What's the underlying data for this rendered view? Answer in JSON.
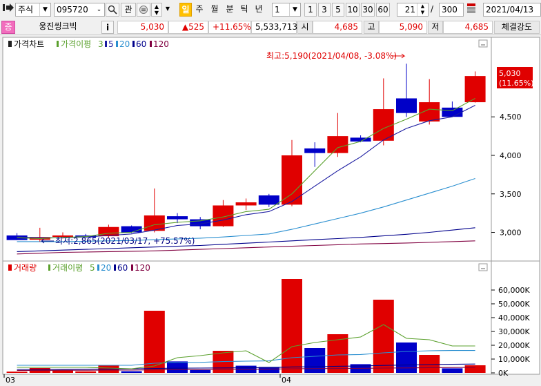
{
  "toolbar": {
    "market": "주식",
    "code": "095720",
    "interest_label": "관",
    "period_tabs": [
      "일",
      "주",
      "월",
      "분",
      "틱",
      "년"
    ],
    "active_period": "일",
    "interval_value": "1",
    "interval_buttons": [
      "1",
      "3",
      "5",
      "10",
      "30",
      "60"
    ],
    "visible_count": "21",
    "total_separator": "/",
    "total_count": "300",
    "date": "2021/04/13"
  },
  "quote": {
    "badge": "증",
    "name": "웅진씽크빅",
    "info_label": "i",
    "price": "5,030",
    "change": "▲525",
    "change_pct": "+11.65%",
    "volume": "5,533,713",
    "open_label": "시",
    "open": "4,685",
    "high_label": "고",
    "high": "5,090",
    "low_label": "저",
    "low": "4,685",
    "strength_label": "체결강도"
  },
  "price_panel": {
    "legend": {
      "title": "가격차트",
      "ma_label": "가격이평",
      "periods": [
        "3",
        "5",
        "20",
        "60",
        "120"
      ]
    },
    "current_price": "5,030",
    "current_pct": "(11.65%)",
    "max_annotation": "최고:5,190(2021/04/08, -3.08%)",
    "min_annotation": "최저:2,865(2021/03/17, +75.57%)",
    "y_ticks": [
      "4,500",
      "4,000",
      "3,500",
      "3,000"
    ]
  },
  "volume_panel": {
    "legend": {
      "title": "거래량",
      "ma_label": "거래이평",
      "periods": [
        "5",
        "20",
        "60",
        "120"
      ]
    },
    "y_ticks": [
      "60,000K",
      "50,000K",
      "40,000K",
      "30,000K",
      "20,000K",
      "10,000K",
      "0K"
    ]
  },
  "x_labels": [
    "03",
    "04"
  ],
  "colors": {
    "up": "#e00000",
    "down": "#0000c8",
    "ma3": "#5aa02c",
    "ma5": "#1a1aa0",
    "ma20": "#2a8fd0",
    "ma60": "#00008b",
    "ma120": "#800040"
  },
  "chart_data": [
    {
      "type": "candlestick",
      "title": "가격차트",
      "x_ticks": [
        "03",
        "04"
      ],
      "candles": [
        {
          "open": 2960,
          "high": 2990,
          "low": 2900,
          "close": 2900
        },
        {
          "open": 2905,
          "high": 3060,
          "low": 2880,
          "close": 2940
        },
        {
          "open": 2945,
          "high": 3000,
          "low": 2920,
          "close": 2960
        },
        {
          "open": 2960,
          "high": 2980,
          "low": 2930,
          "close": 2935
        },
        {
          "open": 2950,
          "high": 3100,
          "low": 2930,
          "close": 3070
        },
        {
          "open": 3080,
          "high": 3090,
          "low": 2990,
          "close": 3000
        },
        {
          "open": 3020,
          "high": 3570,
          "low": 3000,
          "close": 3220
        },
        {
          "open": 3210,
          "high": 3250,
          "low": 3120,
          "close": 3170
        },
        {
          "open": 3170,
          "high": 3200,
          "low": 3040,
          "close": 3080
        },
        {
          "open": 3080,
          "high": 3420,
          "low": 3070,
          "close": 3350
        },
        {
          "open": 3350,
          "high": 3440,
          "low": 3290,
          "close": 3390
        },
        {
          "open": 3480,
          "high": 3500,
          "low": 3330,
          "close": 3360
        },
        {
          "open": 3360,
          "high": 4200,
          "low": 3340,
          "close": 4000
        },
        {
          "open": 4090,
          "high": 4170,
          "low": 3850,
          "close": 4030
        },
        {
          "open": 4030,
          "high": 4550,
          "low": 3980,
          "close": 4250
        },
        {
          "open": 4230,
          "high": 4260,
          "low": 4170,
          "close": 4180
        },
        {
          "open": 4190,
          "high": 5000,
          "low": 4130,
          "close": 4600
        },
        {
          "open": 4740,
          "high": 5190,
          "low": 4500,
          "close": 4550
        },
        {
          "open": 4440,
          "high": 4990,
          "low": 4400,
          "close": 4690
        },
        {
          "open": 4620,
          "high": 4700,
          "low": 4500,
          "close": 4500
        },
        {
          "open": 4690,
          "high": 5090,
          "low": 4685,
          "close": 5030
        }
      ],
      "ma3": [
        2930,
        2920,
        2935,
        2945,
        2990,
        3000,
        3100,
        3130,
        3150,
        3200,
        3270,
        3300,
        3500,
        3800,
        4100,
        4180,
        4350,
        4470,
        4600,
        4580,
        4740
      ],
      "ma5": [
        2940,
        2930,
        2930,
        2940,
        2960,
        2980,
        3030,
        3090,
        3110,
        3160,
        3230,
        3270,
        3400,
        3600,
        3800,
        3980,
        4200,
        4350,
        4450,
        4500,
        4650
      ],
      "ma20": [
        2880,
        2880,
        2880,
        2885,
        2890,
        2895,
        2905,
        2915,
        2925,
        2940,
        2960,
        2980,
        3040,
        3110,
        3180,
        3250,
        3330,
        3420,
        3510,
        3600,
        3700
      ],
      "ma60": [
        2750,
        2760,
        2770,
        2780,
        2790,
        2800,
        2810,
        2820,
        2830,
        2845,
        2860,
        2875,
        2890,
        2905,
        2920,
        2935,
        2955,
        2975,
        3000,
        3030,
        3060
      ],
      "ma120": [
        2720,
        2730,
        2740,
        2745,
        2750,
        2755,
        2760,
        2770,
        2780,
        2790,
        2800,
        2810,
        2820,
        2830,
        2840,
        2850,
        2855,
        2862,
        2870,
        2880,
        2890
      ],
      "ylim": [
        2700,
        5300
      ]
    },
    {
      "type": "bar",
      "title": "거래량",
      "volumes": [
        900,
        3500,
        1700,
        1100,
        5600,
        1200,
        45000,
        8300,
        2100,
        16000,
        5200,
        4300,
        68000,
        18000,
        28000,
        6300,
        53000,
        22000,
        13000,
        3300,
        5500
      ],
      "up": [
        true,
        true,
        true,
        true,
        true,
        false,
        true,
        false,
        false,
        true,
        false,
        false,
        true,
        false,
        true,
        false,
        true,
        false,
        true,
        false,
        true
      ],
      "ma5": [
        4000,
        4000,
        4000,
        4000,
        3500,
        3000,
        5000,
        11000,
        12500,
        14500,
        16000,
        7500,
        19000,
        22000,
        24000,
        26000,
        35000,
        25000,
        24000,
        19500,
        19500
      ],
      "ma20": [
        5500,
        5500,
        5500,
        5500,
        5500,
        5500,
        7000,
        7500,
        7600,
        8200,
        8500,
        8700,
        11000,
        12000,
        13000,
        13300,
        14500,
        15500,
        16000,
        16200,
        16200
      ],
      "ma60": [
        2500,
        2500,
        2600,
        2700,
        2800,
        2900,
        3200,
        3400,
        3500,
        3600,
        3700,
        3800,
        4300,
        4500,
        4800,
        5000,
        5400,
        5700,
        6000,
        6200,
        6400
      ],
      "ma120": [
        1800,
        1800,
        1900,
        1900,
        2000,
        2000,
        2200,
        2300,
        2400,
        2500,
        2600,
        2700,
        3000,
        3100,
        3200,
        3300,
        3500,
        3600,
        3800,
        3900,
        4000
      ],
      "ylim": [
        0,
        70000
      ]
    }
  ]
}
